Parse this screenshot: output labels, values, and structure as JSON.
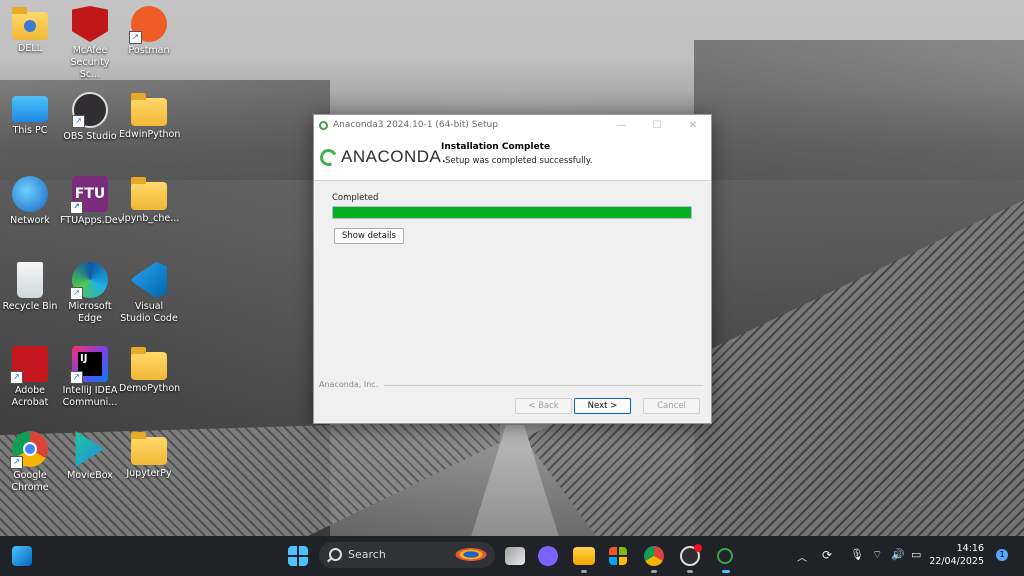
{
  "desktop": {
    "icons": [
      {
        "label": "DELL"
      },
      {
        "label": "McAfee Security Sc..."
      },
      {
        "label": "Postman"
      },
      {
        "label": "This PC"
      },
      {
        "label": "OBS Studio"
      },
      {
        "label": "EdwinPython"
      },
      {
        "label": "Network"
      },
      {
        "label": "FTUApps.Dev"
      },
      {
        "label": ".ipynb_che..."
      },
      {
        "label": "Recycle Bin"
      },
      {
        "label": "Microsoft Edge"
      },
      {
        "label": "Visual Studio Code"
      },
      {
        "label": "Adobe Acrobat"
      },
      {
        "label": "IntelliJ IDEA Communi..."
      },
      {
        "label": "DemoPython"
      },
      {
        "label": "Google Chrome"
      },
      {
        "label": "MovieBox"
      },
      {
        "label": "JupyterPy"
      }
    ],
    "ftu_icon_text": "FTU",
    "ij_icon_text": "IJ"
  },
  "installer": {
    "window_title": "Anaconda3 2024.10-1 (64-bit) Setup",
    "logo_text": "ANACONDA.",
    "header_title": "Installation Complete",
    "header_subtitle": "Setup was completed successfully.",
    "status_label": "Completed",
    "progress_fraction": 1.0,
    "progress_color": "#06b025",
    "show_details_label": "Show details",
    "brand_footer": "Anaconda, Inc.",
    "back_label": "< Back",
    "next_label": "Next >",
    "cancel_label": "Cancel",
    "window_controls": {
      "minimize": "—",
      "maximize": "☐",
      "close": "✕"
    }
  },
  "taskbar": {
    "search_placeholder": "Search",
    "time": "14:16",
    "date": "22/04/2025",
    "notification_count": "1"
  }
}
